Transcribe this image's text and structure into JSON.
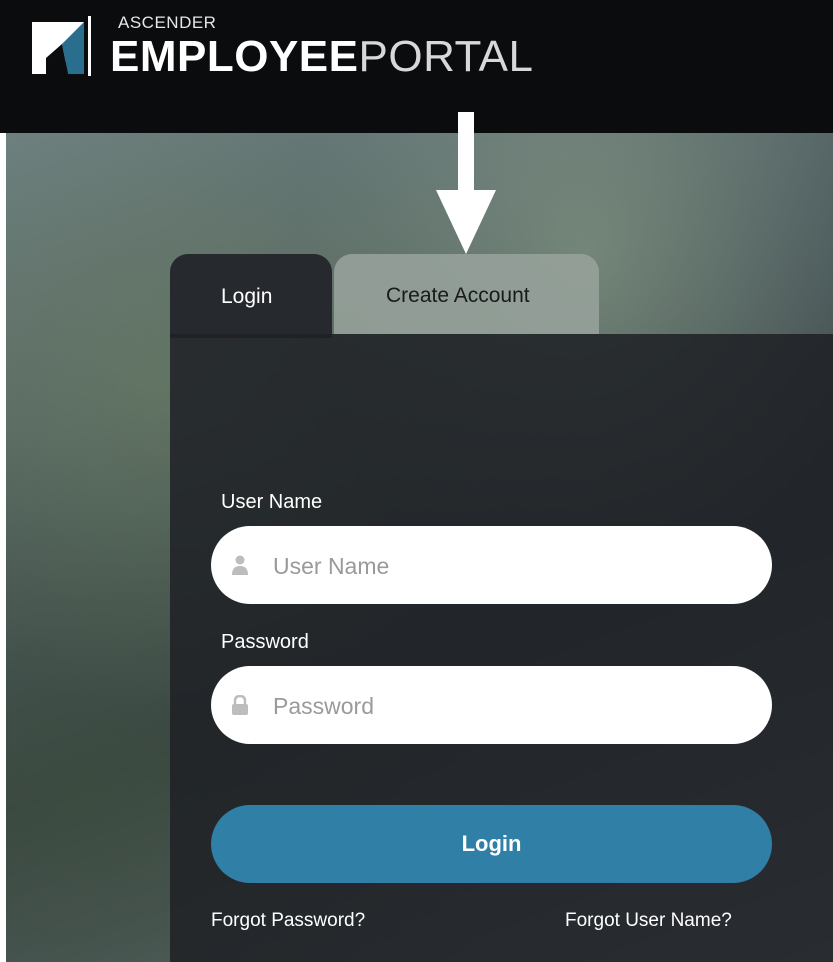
{
  "header": {
    "logo_small": "ASCENDER",
    "logo_bold": "EMPLOYEE",
    "logo_light": "PORTAL",
    "logo_icon": "ascender-logo-icon"
  },
  "tabs": [
    {
      "label": "Login",
      "active": true
    },
    {
      "label": "Create Account",
      "active": false
    }
  ],
  "form": {
    "username_label": "User Name",
    "username_placeholder": "User Name",
    "username_icon": "user-icon",
    "password_label": "Password",
    "password_placeholder": "Password",
    "password_icon": "lock-icon",
    "login_button": "Login",
    "forgot_password": "Forgot Password?",
    "forgot_username": "Forgot User Name?"
  },
  "annotation": {
    "icon": "down-arrow-icon"
  },
  "colors": {
    "header_bg": "#0b0c0e",
    "panel_bg": "#1e2125",
    "button_bg": "#2f7fa6",
    "inactive_tab": "#96a29b"
  }
}
